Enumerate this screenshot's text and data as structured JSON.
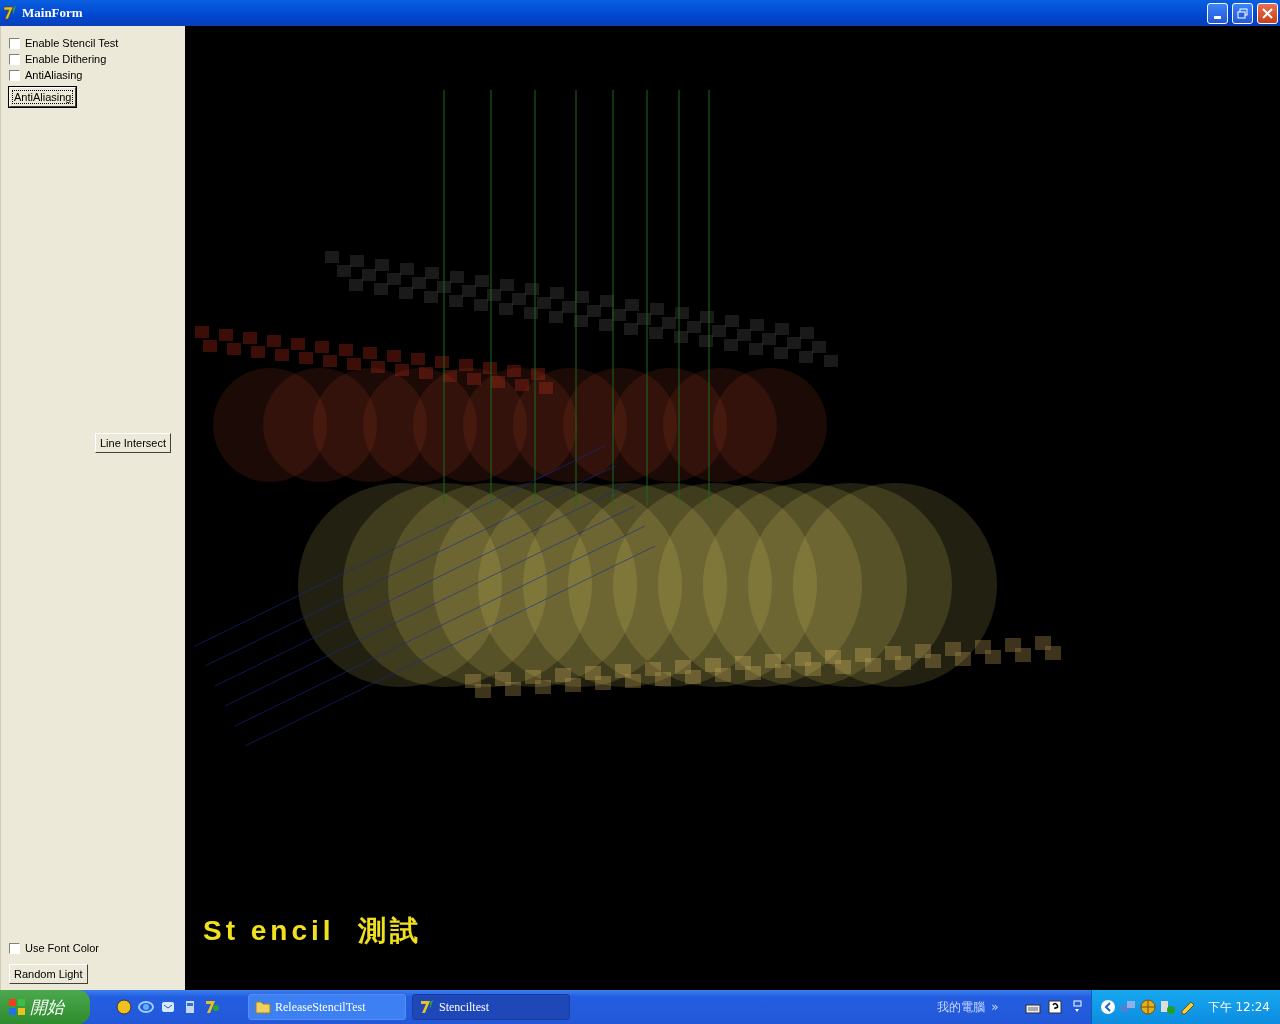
{
  "window": {
    "title": "MainForm"
  },
  "panel": {
    "top_checkboxes": [
      {
        "label": "Enable Stencil Test",
        "checked": false
      },
      {
        "label": "Enable Dithering",
        "checked": false
      },
      {
        "label": "AntiAliasing",
        "checked": false
      }
    ],
    "top_button": {
      "label": "AntiAliasing",
      "focused": true
    },
    "middle_button": {
      "label": "Line Intersect",
      "focused": false
    },
    "bottom_checkbox": {
      "label": "Use Font  Color",
      "checked": false
    },
    "bottom_button": {
      "label": "Random Light",
      "focused": false
    }
  },
  "canvas": {
    "overlay_text": "St encil  測試"
  },
  "taskbar": {
    "start_label": "開始",
    "tasks": [
      {
        "label": "ReleaseStencilTest",
        "selected": false
      },
      {
        "label": "Stenciltest",
        "selected": true
      }
    ],
    "toolbar_label": "我的電腦",
    "chevron": "»",
    "clock": "下午 12:24"
  }
}
